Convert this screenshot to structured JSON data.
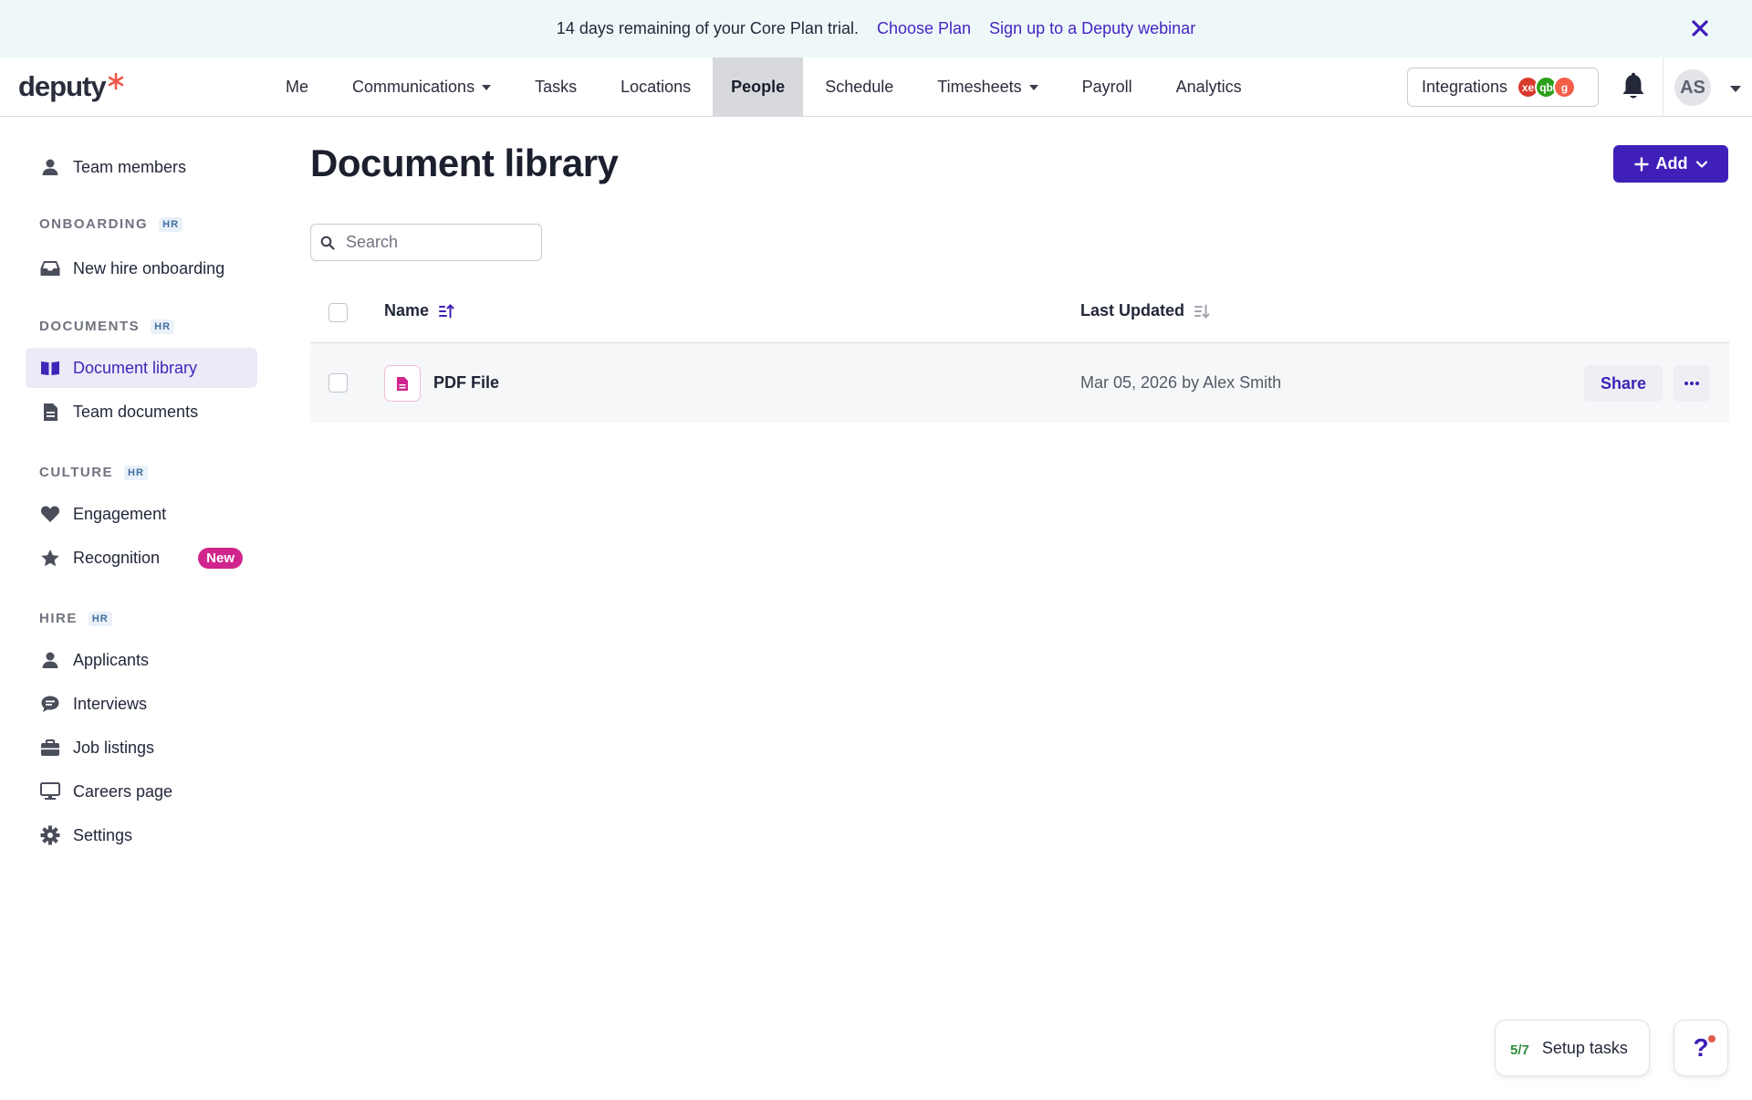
{
  "banner": {
    "message": "14 days remaining of your Core Plan trial.",
    "choose_plan": "Choose Plan",
    "webinar": "Sign up to a Deputy webinar"
  },
  "brand": {
    "logo": "deputy",
    "accent": "#f0584a"
  },
  "nav": {
    "items": [
      "Me",
      "Communications",
      "Tasks",
      "Locations",
      "People",
      "Schedule",
      "Timesheets",
      "Payroll",
      "Analytics"
    ],
    "active": "People",
    "integrations_label": "Integrations",
    "integration_icons": [
      {
        "name": "xero-logo-icon",
        "glyph": "xe",
        "color": "#d83b2e"
      },
      {
        "name": "quickbooks-logo-icon",
        "glyph": "qb",
        "color": "#2ca01c"
      },
      {
        "name": "gusto-logo-icon",
        "glyph": "g",
        "color": "#f45d48"
      }
    ],
    "avatar_initials": "AS"
  },
  "sidebar": {
    "team_members": "Team members",
    "sections": [
      {
        "title": "ONBOARDING",
        "badge": "HR",
        "items": [
          "New hire onboarding"
        ]
      },
      {
        "title": "DOCUMENTS",
        "badge": "HR",
        "items": [
          "Document library",
          "Team documents"
        ]
      },
      {
        "title": "CULTURE",
        "badge": "HR",
        "items": [
          "Engagement",
          "Recognition"
        ]
      },
      {
        "title": "HIRE",
        "badge": "HR",
        "items": [
          "Applicants",
          "Interviews",
          "Job listings",
          "Careers page",
          "Settings"
        ]
      }
    ],
    "active": "Document library",
    "new_badge": "New"
  },
  "main": {
    "title": "Document library",
    "add_label": "Add",
    "search_placeholder": "Search",
    "columns": {
      "name": "Name",
      "last_updated": "Last Updated"
    },
    "rows": [
      {
        "name": "PDF File",
        "last_updated": "Mar 05, 2026 by Alex Smith",
        "share": "Share"
      }
    ]
  },
  "floating": {
    "setup_count": "5/7",
    "setup_label": "Setup tasks",
    "help_glyph": "?"
  },
  "colors": {
    "primary": "#3f1fb8",
    "banner_bg": "#eef8f9",
    "active_nav_bg": "#d8d9dd",
    "new_badge": "#d0258c"
  }
}
